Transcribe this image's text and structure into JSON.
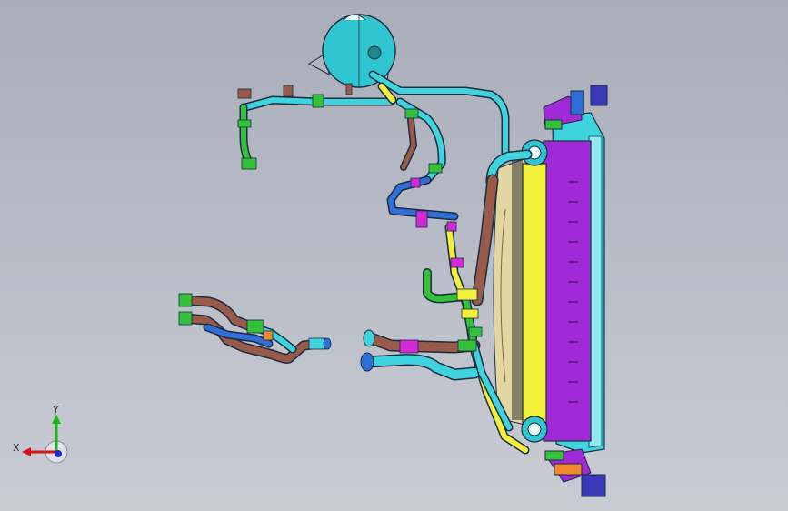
{
  "viewport": {
    "background_top": "#a9adb8",
    "background_bottom": "#c9ccd3"
  },
  "colors": {
    "hose_cyan": "#3fd3de",
    "hose_brown": "#9a5a4a",
    "hose_blue": "#2f6fd6",
    "clamp_green": "#34c23a",
    "radiator_yellow": "#f2f03a",
    "radiator_purple": "#a02ad8",
    "magenta": "#d12ad6",
    "fan_tan": "#e4d6a2",
    "orange": "#f08a2a",
    "axis_red": "#d41414",
    "axis_green": "#18b818",
    "axis_blue": "#1a2bd6"
  },
  "triad": {
    "x_label": "X",
    "y_label": "Y"
  }
}
